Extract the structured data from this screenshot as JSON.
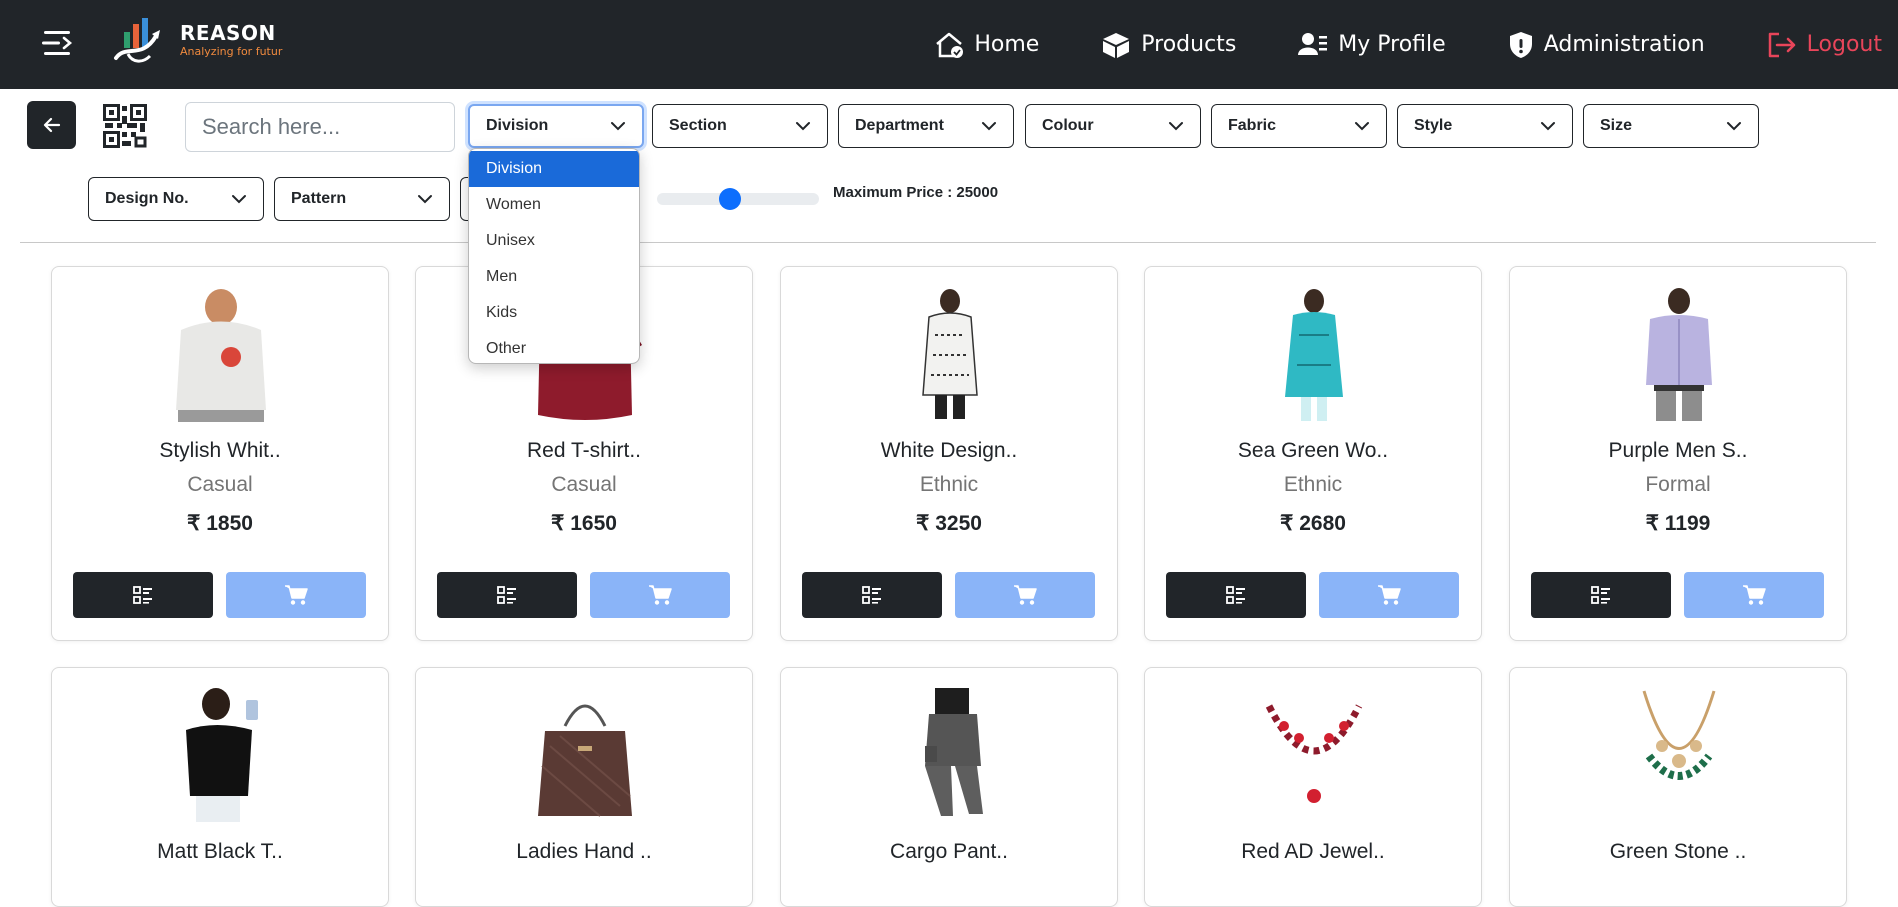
{
  "brand": {
    "name": "REASON",
    "tagline": "Analyzing for futur"
  },
  "nav": {
    "items": [
      {
        "label": "Home",
        "icon": "home-icon"
      },
      {
        "label": "Products",
        "icon": "box-icon"
      },
      {
        "label": "My Profile",
        "icon": "user-list-icon"
      },
      {
        "label": "Administration",
        "icon": "shield-icon"
      },
      {
        "label": "Logout",
        "icon": "logout-icon"
      }
    ]
  },
  "colors": {
    "navbar": "#212529",
    "accent": "#0d6efd",
    "logout": "#e8455a",
    "cart_button": "#8ab4f8"
  },
  "search": {
    "placeholder": "Search here...",
    "value": ""
  },
  "filters": {
    "division": "Division",
    "section": "Section",
    "department": "Department",
    "colour": "Colour",
    "fabric": "Fabric",
    "style": "Style",
    "size": "Size",
    "design_no": "Design No.",
    "pattern": "Pattern"
  },
  "division_dropdown": {
    "options": [
      "Division",
      "Women",
      "Unisex",
      "Men",
      "Kids",
      "Other"
    ],
    "selected_index": 0
  },
  "price_slider": {
    "label": "Maximum Price : 25000",
    "value_fraction": 0.45
  },
  "products": [
    {
      "name": "Stylish Whit..",
      "category": "Casual",
      "price": "₹ 1850"
    },
    {
      "name": "Red T-shirt..",
      "category": "Casual",
      "price": "₹ 1650"
    },
    {
      "name": "White Design..",
      "category": "Ethnic",
      "price": "₹ 3250"
    },
    {
      "name": "Sea Green Wo..",
      "category": "Ethnic",
      "price": "₹ 2680"
    },
    {
      "name": "Purple Men S..",
      "category": "Formal",
      "price": "₹ 1199"
    },
    {
      "name": "Matt Black T..",
      "category": "",
      "price": ""
    },
    {
      "name": "Ladies Hand ..",
      "category": "",
      "price": ""
    },
    {
      "name": "Cargo Pant..",
      "category": "",
      "price": ""
    },
    {
      "name": "Red AD Jewel..",
      "category": "",
      "price": ""
    },
    {
      "name": "Green Stone ..",
      "category": "",
      "price": ""
    }
  ]
}
